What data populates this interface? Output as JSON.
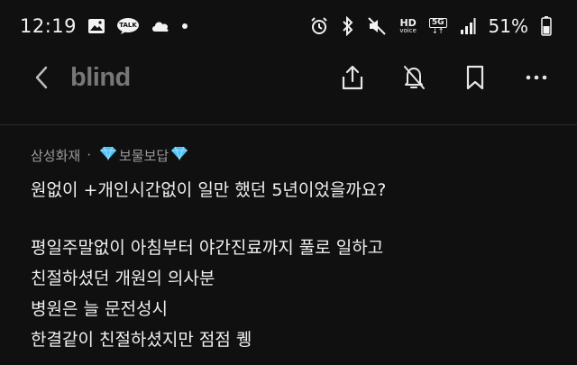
{
  "status_bar": {
    "time": "12:19",
    "talk_label": "TALK",
    "hd_label": "HD",
    "voice_label": "voice",
    "network_label": "5G",
    "network_arrows": "↓↑",
    "battery_percent": "51%"
  },
  "app_bar": {
    "brand": "blind"
  },
  "post": {
    "company": "삼성화재",
    "separator": "·",
    "nickname": "보물보답",
    "title": "원없이 +개인시간없이 일만 했던 5년이었을까요?",
    "body_lines": [
      "평일주말없이 아침부터 야간진료까지 풀로 일하고",
      "친절하셨던 개원의 의사분",
      "병원은 늘 문전성시",
      "한결같이 친절하셨지만 점점  퀭"
    ]
  },
  "colors": {
    "background": "#101010",
    "text": "#f0f0f0",
    "muted": "#9a9a9a",
    "brand": "#777777",
    "gem": "#4fc3f7"
  }
}
